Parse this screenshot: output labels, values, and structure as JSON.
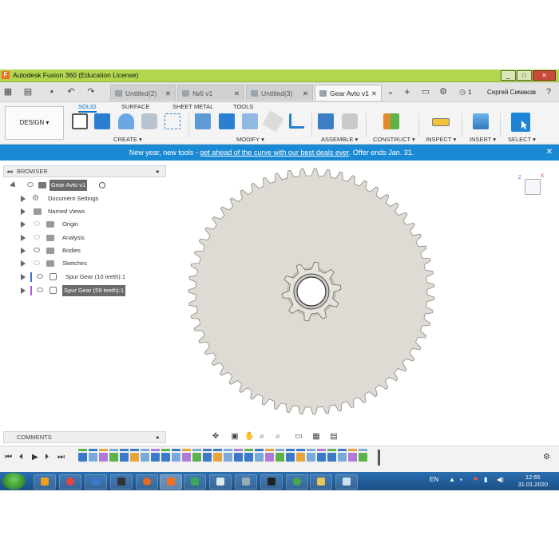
{
  "window": {
    "app_title": "Autodesk Fusion 360 (Education License)",
    "controls": [
      "_",
      "□",
      "✕"
    ]
  },
  "tabs": [
    {
      "label": "Untitled(2)",
      "active": false
    },
    {
      "label": "№6 v1",
      "active": false
    },
    {
      "label": "Untitled(3)",
      "active": false
    },
    {
      "label": "Gear Avto v1",
      "active": true
    }
  ],
  "topbar": {
    "job_count": "1",
    "user_name": "Сергей Симаков"
  },
  "ribbon": {
    "workspace": "DESIGN ▾",
    "tabs": [
      "SOLID",
      "SURFACE",
      "SHEET METAL",
      "TOOLS"
    ],
    "groups": [
      "CREATE ▾",
      "MODIFY ▾",
      "ASSEMBLE ▾",
      "CONSTRUCT ▾",
      "INSPECT ▾",
      "INSERT ▾",
      "SELECT ▾"
    ]
  },
  "banner": {
    "prefix": "New year, new tools - ",
    "link": "get ahead of the curve with our best deals ever",
    "suffix": ". Offer ends Jan. 31.",
    "close": "✕"
  },
  "browser": {
    "title": "BROWSER",
    "root": "Gear Avto v1",
    "items": [
      {
        "label": "Document Settings",
        "icon": "gear-icon"
      },
      {
        "label": "Named Views",
        "icon": "folder-icon"
      },
      {
        "label": "Origin",
        "icon": "folder-icon"
      },
      {
        "label": "Analysis",
        "icon": "folder-icon"
      },
      {
        "label": "Bodies",
        "icon": "folder-icon"
      },
      {
        "label": "Sketches",
        "icon": "folder-icon"
      },
      {
        "label": "Spur Gear (10 teeth):1",
        "icon": "component-icon"
      },
      {
        "label": "Spur Gear (59 teeth):1",
        "icon": "component-icon"
      }
    ]
  },
  "comments": {
    "title": "COMMENTS"
  },
  "viewcube": {
    "axis_z": "Z",
    "axis_x": "X"
  },
  "taskbar": {
    "lang": "EN",
    "time": "12:55",
    "date": "31.01.2020"
  },
  "colors": {
    "titlebar": "#b2d650",
    "banner": "#1a8ad4",
    "accent_blue": "#0a73c8",
    "gear_fill": "#dedbd5",
    "gear_stroke": "#8e8a82",
    "selected_row": "#6a6a6a"
  }
}
